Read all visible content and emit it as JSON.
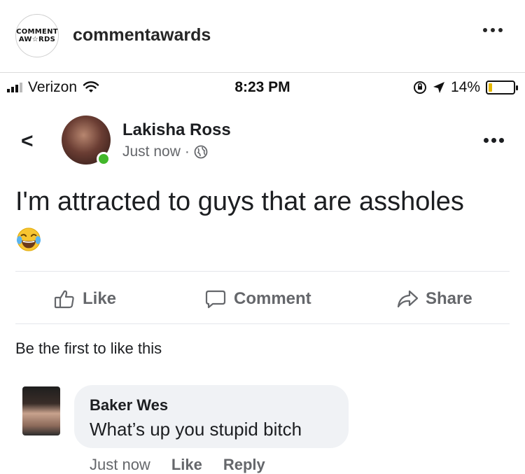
{
  "instagram": {
    "logo_line1": "COMMENT",
    "logo_line2": "AW☆RDS",
    "username": "commentawards"
  },
  "statusbar": {
    "carrier": "Verizon",
    "time": "8:23 PM",
    "battery": "14%",
    "battery_level": 0.14
  },
  "post": {
    "author": "Lakisha Ross",
    "time": "Just now",
    "separator": "·",
    "text": "I'm attracted to guys that are assholes",
    "emoji": "face-with-tears-of-joy"
  },
  "actions": {
    "like": "Like",
    "comment": "Comment",
    "share": "Share"
  },
  "likes_summary": "Be the first to like this",
  "comment": {
    "author": "Baker Wes",
    "text": "What’s up you stupid bitch",
    "time": "Just now",
    "like": "Like",
    "reply": "Reply"
  },
  "colors": {
    "online": "#42b72a",
    "secondary_text": "#65676b",
    "bubble": "#f0f2f5",
    "battery": "#e6b800"
  }
}
